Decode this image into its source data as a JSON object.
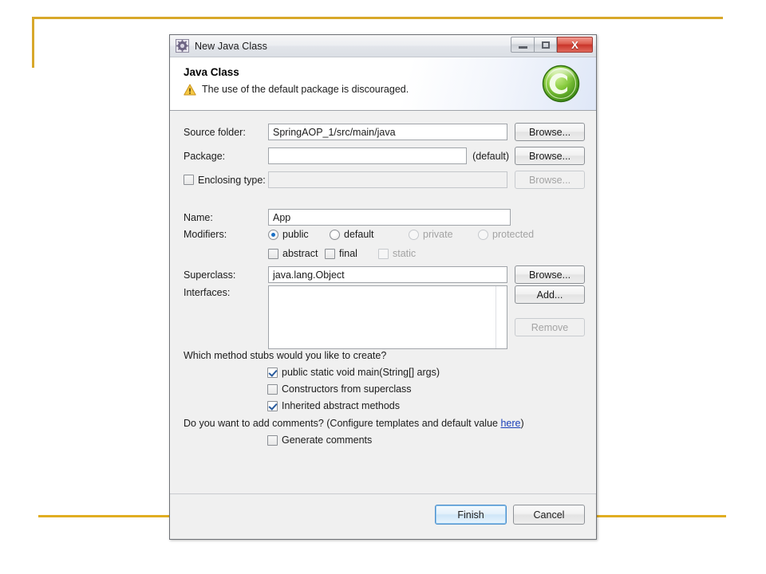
{
  "window": {
    "title": "New Java Class",
    "icon": "java-class-wizard-icon",
    "controls": {
      "minimize": "minimize-icon",
      "maximize": "maximize-icon",
      "close": "X"
    }
  },
  "header": {
    "title": "Java Class",
    "message": "The use of the default package is discouraged.",
    "message_icon": "warning-icon",
    "logo": "C",
    "warning_color": "#f0b323"
  },
  "form": {
    "source_folder": {
      "label": "Source folder:",
      "value": "SpringAOP_1/src/main/java",
      "browse": "Browse..."
    },
    "package": {
      "label": "Package:",
      "value": "",
      "suffix": "(default)",
      "browse": "Browse..."
    },
    "enclosing_type": {
      "label": "Enclosing type:",
      "value": "",
      "checked": false,
      "browse": "Browse..."
    },
    "name": {
      "label": "Name:",
      "value": "App"
    },
    "modifiers": {
      "label": "Modifiers:",
      "radios": [
        {
          "label": "public",
          "checked": true,
          "disabled": false
        },
        {
          "label": "default",
          "checked": false,
          "disabled": false
        },
        {
          "label": "private",
          "checked": false,
          "disabled": true
        },
        {
          "label": "protected",
          "checked": false,
          "disabled": true
        }
      ],
      "checkboxes": [
        {
          "label": "abstract",
          "checked": false,
          "disabled": false
        },
        {
          "label": "final",
          "checked": false,
          "disabled": false
        },
        {
          "label": "static",
          "checked": false,
          "disabled": true
        }
      ]
    },
    "superclass": {
      "label": "Superclass:",
      "value": "java.lang.Object",
      "browse": "Browse..."
    },
    "interfaces": {
      "label": "Interfaces:",
      "items": [],
      "add": "Add...",
      "remove": "Remove"
    }
  },
  "stubs": {
    "question": "Which method stubs would you like to create?",
    "options": [
      {
        "label": "public static void main(String[] args)",
        "checked": true
      },
      {
        "label": "Constructors from superclass",
        "checked": false
      },
      {
        "label": "Inherited abstract methods",
        "checked": true
      }
    ]
  },
  "comments": {
    "question_before": "Do you want to add comments? (Configure templates and default value ",
    "link": "here",
    "question_after": ")",
    "option": {
      "label": "Generate comments",
      "checked": false
    }
  },
  "footer": {
    "finish": "Finish",
    "cancel": "Cancel"
  }
}
